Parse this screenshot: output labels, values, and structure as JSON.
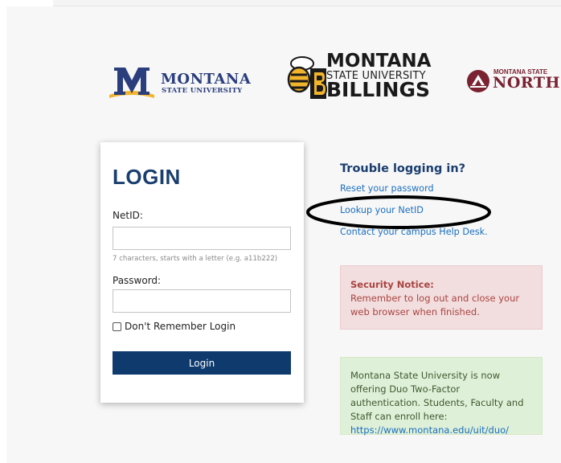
{
  "logos": {
    "msu": {
      "line1": "MONTANA",
      "line2": "STATE UNIVERSITY"
    },
    "billings": {
      "line1": "MONTANA",
      "line2": "STATE UNIVERSITY",
      "line3": "BILLINGS"
    },
    "northern": {
      "line1": "MONTANA STATE",
      "line2": "NORTH"
    }
  },
  "login": {
    "title": "LOGIN",
    "netid_label": "NetID:",
    "netid_value": "",
    "netid_hint": "7 characters, starts with a letter (e.g. a11b222)",
    "password_label": "Password:",
    "password_value": "",
    "remember_label": "Don't Remember Login",
    "button_label": "Login"
  },
  "trouble": {
    "title": "Trouble logging in?",
    "links": [
      {
        "label": "Reset your password"
      },
      {
        "label": "Lookup your NetID"
      },
      {
        "label": "Contact your campus Help Desk."
      }
    ]
  },
  "security_notice": {
    "heading": "Security Notice:",
    "body": "Remember to log out and close your web browser when finished."
  },
  "duo_notice": {
    "body": "Montana State University is now offering Duo Two-Factor authentication. Students, Faculty and Staff can enroll here: ",
    "link": "https://www.montana.edu/uit/duo/"
  },
  "colors": {
    "brand_navy": "#0e3a6e",
    "link_blue": "#1b6fc0",
    "alert_red_bg": "#f2dede",
    "alert_green_bg": "#dff0d8",
    "msu_gold": "#f2b42c",
    "northern_maroon": "#7a2232"
  },
  "icons": [
    "msu-m-icon",
    "yellowjacket-icon",
    "northern-seal-icon"
  ],
  "annotation": {
    "type": "hand-drawn-ellipse",
    "target": "Lookup your NetID"
  }
}
